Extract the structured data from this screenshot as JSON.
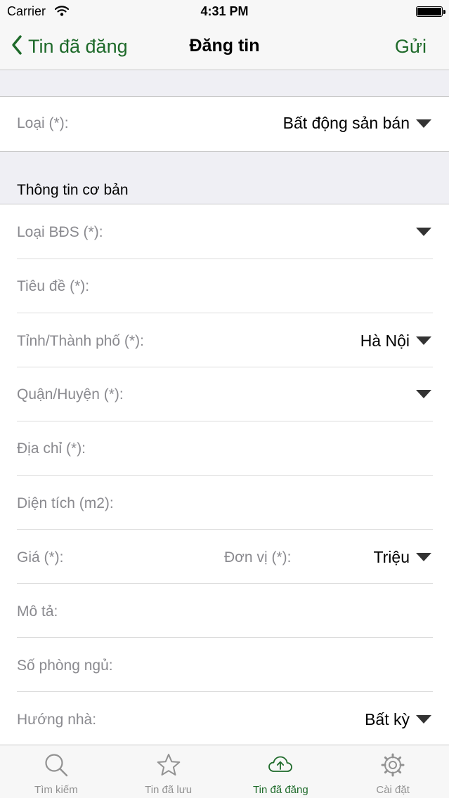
{
  "status_bar": {
    "carrier": "Carrier",
    "time": "4:31 PM"
  },
  "nav": {
    "back_label": "Tin đã đăng",
    "title": "Đăng tin",
    "send_label": "Gửi"
  },
  "category": {
    "label": "Loại (*):",
    "value": "Bất động sản bán"
  },
  "section": {
    "title": "Thông tin cơ bản"
  },
  "form": {
    "property_type": {
      "label": "Loại BĐS (*):",
      "value": ""
    },
    "title": {
      "label": "Tiêu đề (*):",
      "value": ""
    },
    "province": {
      "label": "Tỉnh/Thành phố (*):",
      "value": "Hà Nội"
    },
    "district": {
      "label": "Quận/Huyện (*):",
      "value": ""
    },
    "address": {
      "label": "Địa chỉ (*):",
      "value": ""
    },
    "area": {
      "label": "Diện tích (m2):",
      "value": ""
    },
    "price": {
      "label": "Giá (*):",
      "value": "",
      "unit_label": "Đơn vị (*):",
      "unit_value": "Triệu"
    },
    "description": {
      "label": "Mô tả:",
      "value": ""
    },
    "bedrooms": {
      "label": "Số phòng ngủ:",
      "value": ""
    },
    "direction": {
      "label": "Hướng nhà:",
      "value": "Bất kỳ"
    }
  },
  "tabs": [
    {
      "label": "Tìm kiếm",
      "icon": "search-icon",
      "active": false
    },
    {
      "label": "Tin đã lưu",
      "icon": "star-icon",
      "active": false
    },
    {
      "label": "Tin đã đăng",
      "icon": "cloud-upload-icon",
      "active": true
    },
    {
      "label": "Cài đặt",
      "icon": "gear-icon",
      "active": false
    }
  ],
  "colors": {
    "accent": "#1e6a2a",
    "inactive": "#929292",
    "label": "#8a8a8f",
    "group_bg": "#efeff4",
    "bar_bg": "#f7f7f7"
  }
}
